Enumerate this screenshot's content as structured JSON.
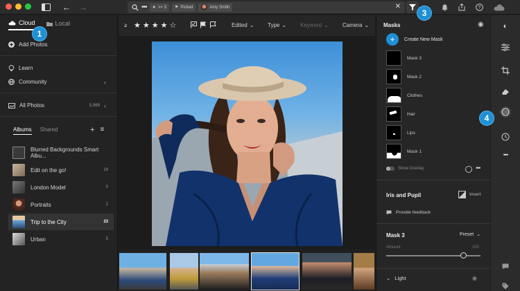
{
  "search": {
    "chips": [
      {
        "icon": "star-icon",
        "label": ">= 3"
      },
      {
        "icon": "flag-icon",
        "label": "Picked"
      },
      {
        "icon": "face-icon",
        "label": "Amy Smith"
      }
    ]
  },
  "left_panel": {
    "source_tabs": [
      {
        "label": "Cloud",
        "icon": "cloud-icon",
        "active": true
      },
      {
        "label": "Local",
        "icon": "folder-icon",
        "active": false
      }
    ],
    "add_photos": "Add Photos",
    "learn": "Learn",
    "community": "Community",
    "all_photos": {
      "label": "All Photos",
      "count": "5,969"
    },
    "album_tabs": [
      {
        "label": "Albums",
        "active": true
      },
      {
        "label": "Shared",
        "active": false
      }
    ],
    "albums": [
      {
        "name": "Blurred Backgrounds Smart Albu...",
        "count": ""
      },
      {
        "name": "Edit on the go!",
        "count": "19"
      },
      {
        "name": "London Model",
        "count": "0"
      },
      {
        "name": "Portraits",
        "count": "2"
      },
      {
        "name": "Trip to the City",
        "count": "23",
        "selected": true
      },
      {
        "name": "Urban",
        "count": "5"
      }
    ]
  },
  "toolbar": {
    "rating_glyph": "≥",
    "edited": "Edited",
    "type": "Type",
    "keyword": "Keyword",
    "camera": "Camera"
  },
  "masks_panel": {
    "title": "Masks",
    "create_new": "Create New Mask",
    "masks": [
      "Mask 3",
      "Mask 2",
      "Clothes",
      "Hair",
      "Lips",
      "Mask 1"
    ],
    "show_overlay": "Show Overlay",
    "iris_title": "Iris and Pupil",
    "invert": "Invert",
    "feedback": "Provide feedback",
    "mask_name": "Mask 3",
    "preset": "Preset",
    "amount_label": "Amount",
    "amount_max": "100",
    "amount_value": 0.82,
    "light": "Light"
  },
  "callouts": [
    "1",
    "3",
    "4"
  ],
  "colors": {
    "accent": "#1e90d6",
    "panel": "#262626",
    "background": "#1e1e1e"
  }
}
